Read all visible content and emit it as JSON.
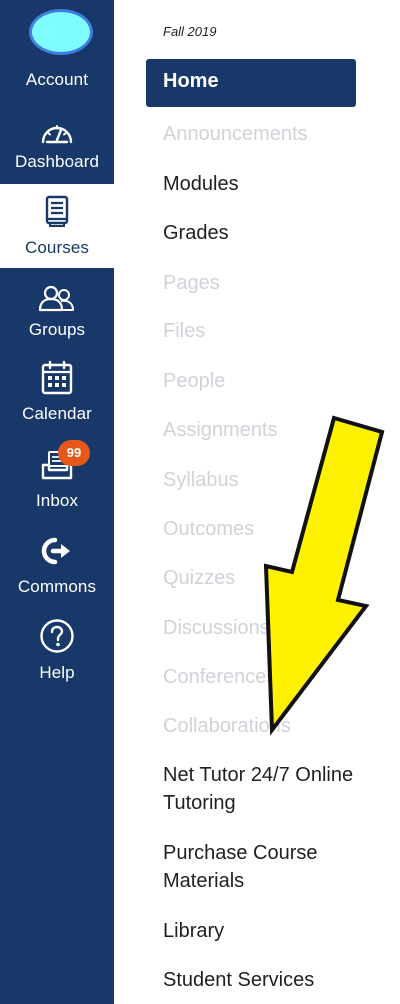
{
  "global_nav": {
    "items": [
      {
        "key": "account",
        "label": "Account",
        "icon": "avatar"
      },
      {
        "key": "dashboard",
        "label": "Dashboard",
        "icon": "dashboard-icon"
      },
      {
        "key": "courses",
        "label": "Courses",
        "icon": "courses-icon",
        "active": true
      },
      {
        "key": "groups",
        "label": "Groups",
        "icon": "groups-icon"
      },
      {
        "key": "calendar",
        "label": "Calendar",
        "icon": "calendar-icon"
      },
      {
        "key": "inbox",
        "label": "Inbox",
        "icon": "inbox-icon",
        "badge": "99"
      },
      {
        "key": "commons",
        "label": "Commons",
        "icon": "commons-icon"
      },
      {
        "key": "help",
        "label": "Help",
        "icon": "help-icon"
      }
    ]
  },
  "course_nav": {
    "term": "Fall 2019",
    "active": "Home",
    "links": [
      {
        "label": "Announcements",
        "enabled": false
      },
      {
        "label": "Modules",
        "enabled": true
      },
      {
        "label": "Grades",
        "enabled": true
      },
      {
        "label": "Pages",
        "enabled": false
      },
      {
        "label": "Files",
        "enabled": false
      },
      {
        "label": "People",
        "enabled": false
      },
      {
        "label": "Assignments",
        "enabled": false
      },
      {
        "label": "Syllabus",
        "enabled": false
      },
      {
        "label": "Outcomes",
        "enabled": false
      },
      {
        "label": "Quizzes",
        "enabled": false
      },
      {
        "label": "Discussions",
        "enabled": false
      },
      {
        "label": "Conferences",
        "enabled": false
      },
      {
        "label": "Collaborations",
        "enabled": false
      },
      {
        "label": "Net Tutor 24/7 Online Tutoring",
        "enabled": true
      },
      {
        "label": "Purchase Course Materials",
        "enabled": true
      },
      {
        "label": "Library",
        "enabled": true
      },
      {
        "label": "Student Services",
        "enabled": true
      }
    ]
  },
  "colors": {
    "nav_bg": "#173868",
    "avatar_fill": "#7ffcff",
    "badge": "#e5581a",
    "disabled_text": "#cfd3d8",
    "arrow_fill": "#fff200"
  },
  "annotation": {
    "arrow_icon": "yellow-arrow-icon"
  }
}
